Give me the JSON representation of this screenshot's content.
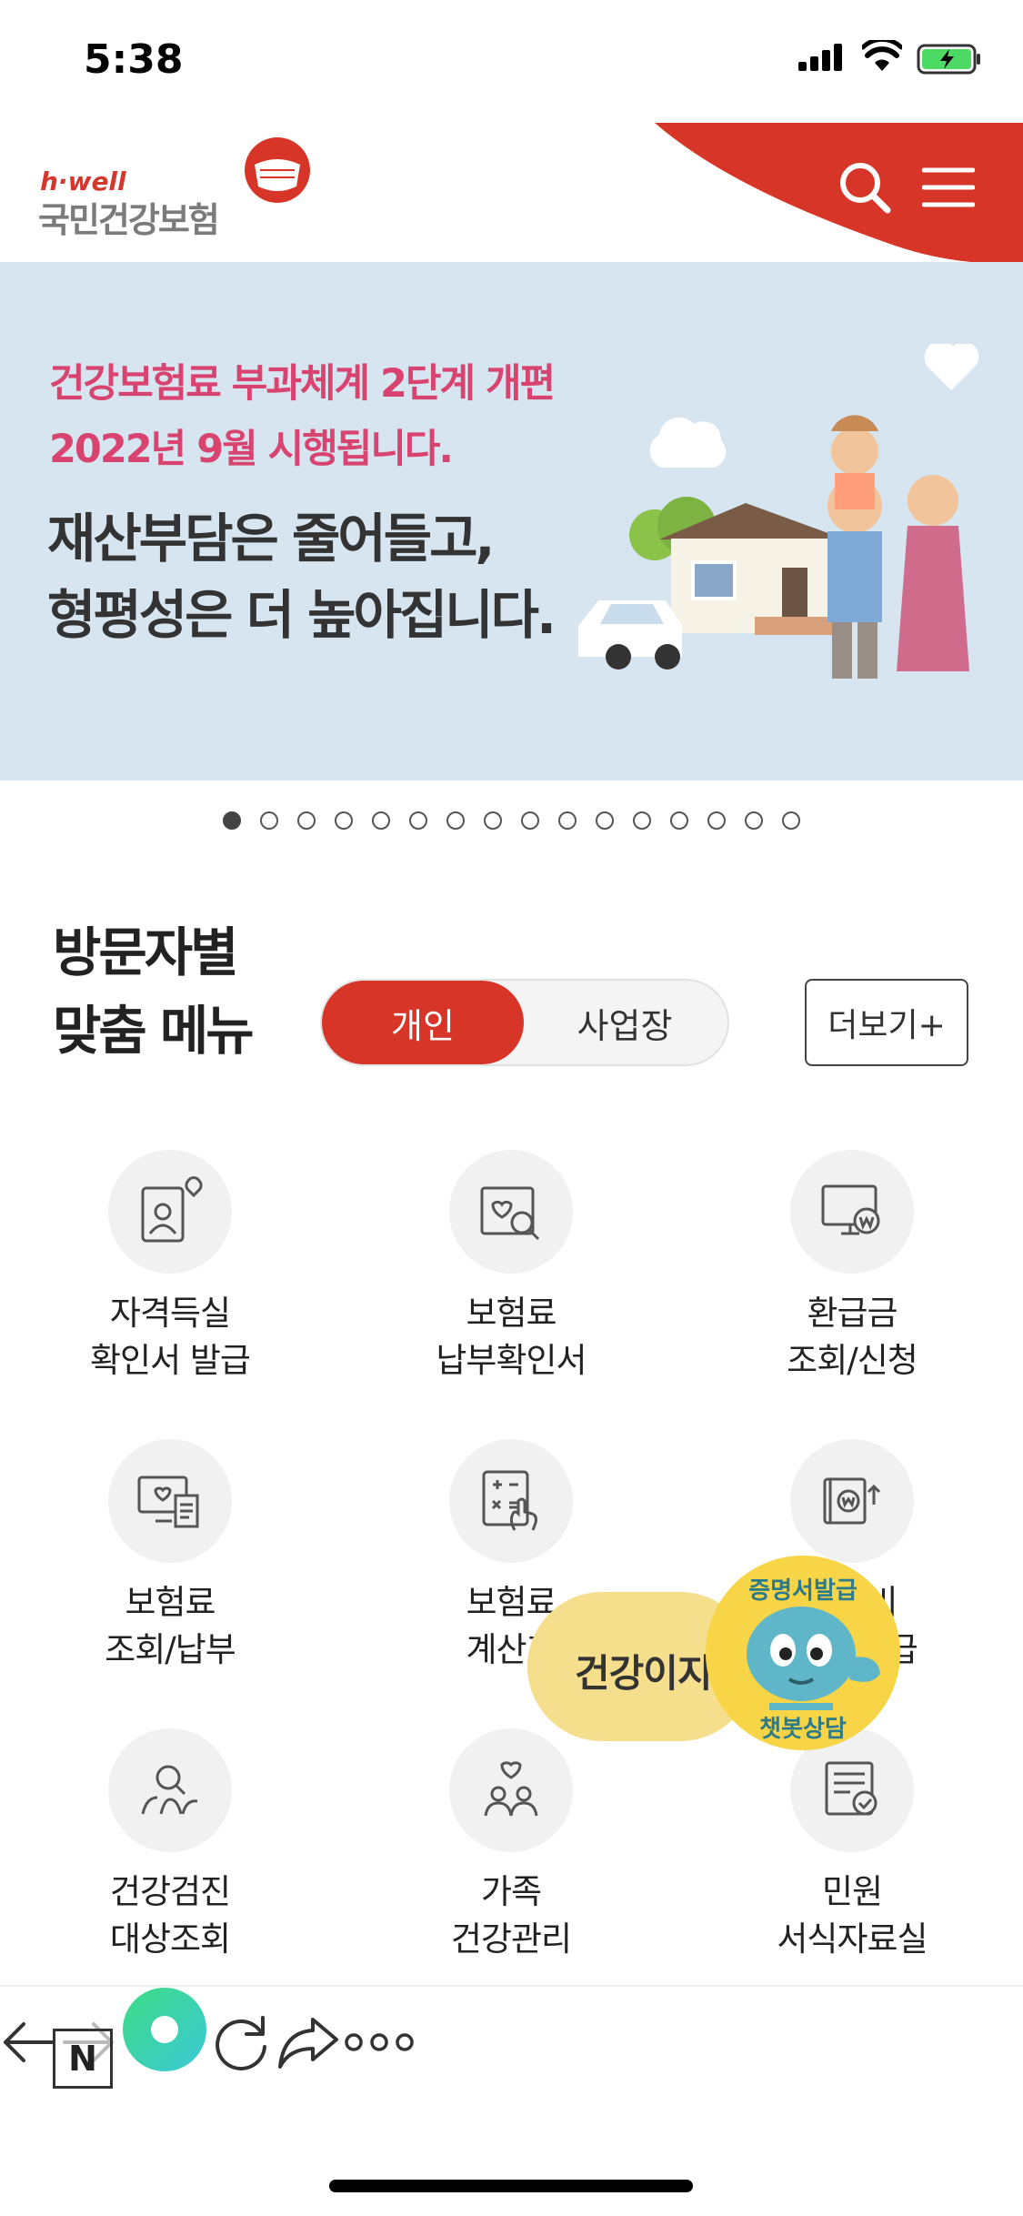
{
  "status": {
    "time": "5:38"
  },
  "header": {
    "logo_sub": "h·well",
    "logo_name": "국민건강보험",
    "accent": "#d63527"
  },
  "banner": {
    "sub_line1": "건강보험료 부과체계 2단계 개편",
    "sub_line2": "2022년 9월 시행됩니다.",
    "head_line1": "재산부담은 줄어들고,",
    "head_line2": "형평성은 더 높아집니다.",
    "page_count": 16,
    "active_page": 1
  },
  "menu": {
    "title_line1": "방문자별",
    "title_line2": "맞춤 메뉴",
    "toggle_personal": "개인",
    "toggle_business": "사업장",
    "more": "더보기+"
  },
  "items": [
    {
      "l1": "자격득실",
      "l2": "확인서 발급",
      "icon": "certificate-heart-icon"
    },
    {
      "l1": "보험료",
      "l2": "납부확인서",
      "icon": "document-search-icon"
    },
    {
      "l1": "환급금",
      "l2": "조회/신청",
      "icon": "monitor-won-icon"
    },
    {
      "l1": "보험료",
      "l2": "조회/납부",
      "icon": "monitor-receipt-icon"
    },
    {
      "l1": "보험료",
      "l2": "계산기",
      "icon": "calculator-icon"
    },
    {
      "l1": "진료비",
      "l2": "확인/환급",
      "icon": "wallet-won-icon"
    },
    {
      "l1": "건강검진",
      "l2": "대상조회",
      "icon": "people-search-icon"
    },
    {
      "l1": "가족",
      "l2": "건강관리",
      "icon": "family-heart-icon"
    },
    {
      "l1": "민원",
      "l2": "서식자료실",
      "icon": "form-check-icon"
    }
  ],
  "floating": {
    "label": "건강이지",
    "bot_top": "증명서발급",
    "bot_bottom": "챗봇상담"
  },
  "browser": {
    "n_label": "N"
  }
}
